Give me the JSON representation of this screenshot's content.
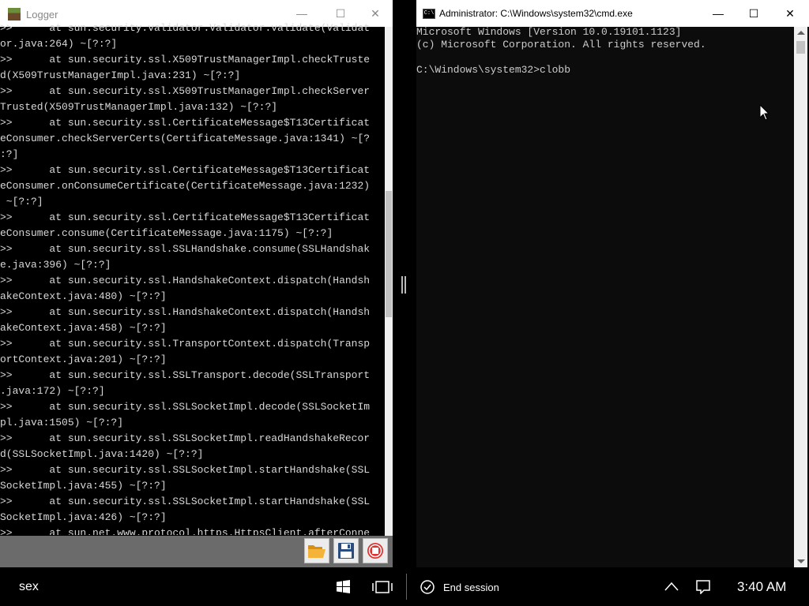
{
  "logger": {
    "title": "Logger",
    "controls": {
      "minimize": "—",
      "maximize": "☐",
      "close": "✕"
    },
    "lines": [
      ">>      at sun.security.validator.Validator.validate(Validat",
      "or.java:264) ~[?:?]",
      ">>      at sun.security.ssl.X509TrustManagerImpl.checkTruste",
      "d(X509TrustManagerImpl.java:231) ~[?:?]",
      ">>      at sun.security.ssl.X509TrustManagerImpl.checkServer",
      "Trusted(X509TrustManagerImpl.java:132) ~[?:?]",
      ">>      at sun.security.ssl.CertificateMessage$T13Certificat",
      "eConsumer.checkServerCerts(CertificateMessage.java:1341) ~[?",
      ":?]",
      ">>      at sun.security.ssl.CertificateMessage$T13Certificat",
      "eConsumer.onConsumeCertificate(CertificateMessage.java:1232)",
      " ~[?:?]",
      ">>      at sun.security.ssl.CertificateMessage$T13Certificat",
      "eConsumer.consume(CertificateMessage.java:1175) ~[?:?]",
      ">>      at sun.security.ssl.SSLHandshake.consume(SSLHandshak",
      "e.java:396) ~[?:?]",
      ">>      at sun.security.ssl.HandshakeContext.dispatch(Handsh",
      "akeContext.java:480) ~[?:?]",
      ">>      at sun.security.ssl.HandshakeContext.dispatch(Handsh",
      "akeContext.java:458) ~[?:?]",
      ">>      at sun.security.ssl.TransportContext.dispatch(Transp",
      "ortContext.java:201) ~[?:?]",
      ">>      at sun.security.ssl.SSLTransport.decode(SSLTransport",
      ".java:172) ~[?:?]",
      ">>      at sun.security.ssl.SSLSocketImpl.decode(SSLSocketIm",
      "pl.java:1505) ~[?:?]",
      ">>      at sun.security.ssl.SSLSocketImpl.readHandshakeRecor",
      "d(SSLSocketImpl.java:1420) ~[?:?]",
      ">>      at sun.security.ssl.SSLSocketImpl.startHandshake(SSL",
      "SocketImpl.java:455) ~[?:?]",
      ">>      at sun.security.ssl.SSLSocketImpl.startHandshake(SSL",
      "SocketImpl.java:426) ~[?:?]",
      ">>      at sun.net.www.protocol.https.HttpsClient.afterConne"
    ],
    "toolbar": [
      "folder-open-icon",
      "save-icon",
      "stop-icon"
    ]
  },
  "cmd": {
    "title": "Administrator: C:\\Windows\\system32\\cmd.exe",
    "icon_text": "C:\\",
    "controls": {
      "minimize": "—",
      "maximize": "☐",
      "close": "✕"
    },
    "lines": [
      "Microsoft Windows [Version 10.0.19101.1123]",
      "(c) Microsoft Corporation. All rights reserved.",
      "",
      "C:\\Windows\\system32>clobb"
    ]
  },
  "taskbar": {
    "user": "sex",
    "end_session": "End session",
    "clock": "3:40 AM",
    "icons": [
      "windows-icon",
      "task-view-icon",
      "check-circle-icon",
      "chevron-up-icon",
      "notification-icon"
    ]
  },
  "colors": {
    "console_bg": "#0c0c0c",
    "console_text": "#cccccc",
    "stop_red": "#e0312f",
    "folder_orange": "#f0a020",
    "save_blue": "#2b4d7e"
  }
}
